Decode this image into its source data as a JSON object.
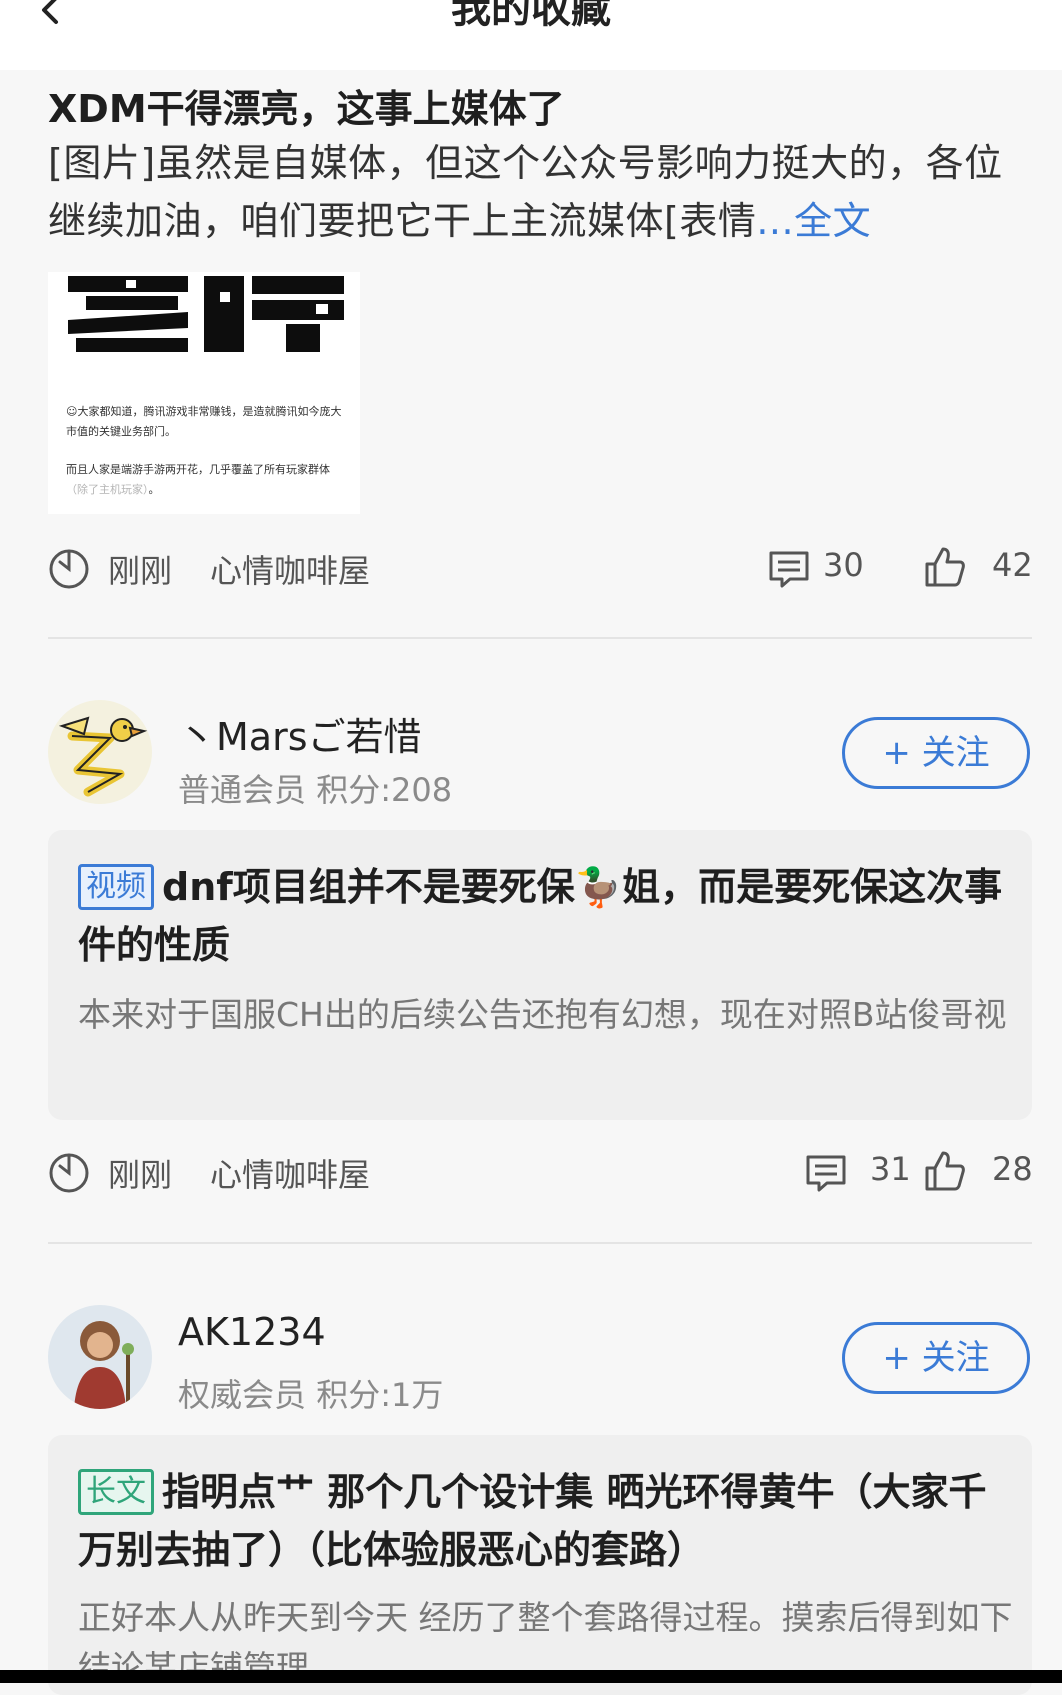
{
  "header": {
    "title": "我的收藏"
  },
  "post1": {
    "title": "XDM干得漂亮，这事上媒体了",
    "body": "[图片]虽然是自媒体，但这个公众号影响力挺大的，各位继续加油，咱们要把它干上主流媒体[表情",
    "ellipsis": "...",
    "fulltext_label": "全文",
    "image": {
      "logo_text": "差评",
      "line1": "大家都知道，腾讯游戏非常赚钱，是造就腾讯如今庞大市值的关键业务部门。",
      "line2": "而且人家是端游手游两开花，几乎覆盖了所有玩家群体",
      "line2_gray": "（除了主机玩家）",
      "line2_end": "。"
    },
    "meta": {
      "time": "刚刚",
      "forum": "心情咖啡屋",
      "comments": "30",
      "likes": "42"
    }
  },
  "post2": {
    "user": {
      "name": "丶Marsご若惜",
      "level": "普通会员",
      "points": "积分:208"
    },
    "follow_label": "+ 关注",
    "tag": "视频",
    "title": "dnf项目组并不是要死保🦆姐，而是要死保这次事件的性质",
    "summary": "本来对于国服CH出的后续公告还抱有幻想，现在对照B站俊哥视",
    "meta": {
      "time": "刚刚",
      "forum": "心情咖啡屋",
      "comments": "31",
      "likes": "28"
    }
  },
  "post3": {
    "user": {
      "name": "AK1234",
      "level": "权威会员",
      "points": "积分:1万"
    },
    "follow_label": "+ 关注",
    "tag": "长文",
    "title": "指明点艹 那个几个设计集 晒光环得黄牛（大家千万别去抽了）（比体验服恶心的套路）",
    "summary": "正好本人从昨天到今天 经历了整个套路得过程。摸索后得到如下结论某店铺管理"
  },
  "colors": {
    "accent": "#3b7bd6",
    "long_tag": "#2fa57a"
  },
  "icons": [
    "back-arrow-icon",
    "clock-icon",
    "comment-icon",
    "thumbs-up-icon"
  ]
}
